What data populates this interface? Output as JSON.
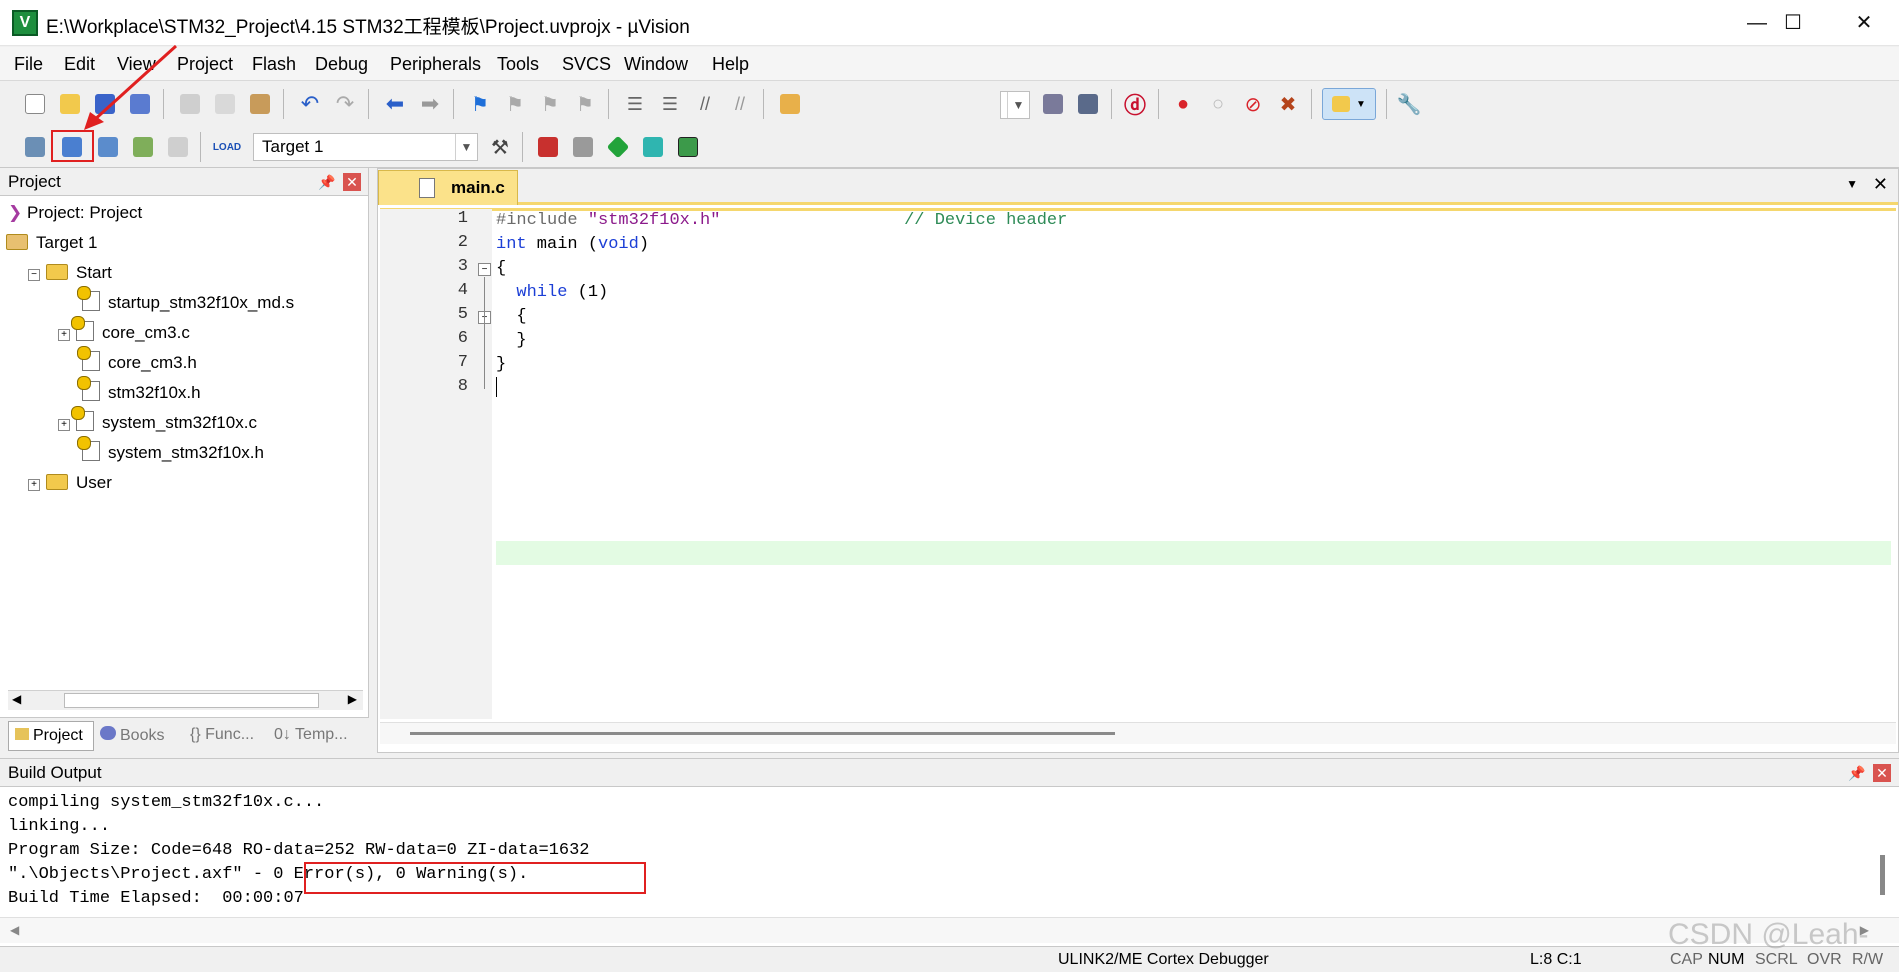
{
  "window": {
    "title": "E:\\Workplace\\STM32_Project\\4.15 STM32工程模板\\Project.uvprojx - µVision",
    "minimize": "—",
    "maximize": "☐",
    "close": "✕"
  },
  "menu": [
    "File",
    "Edit",
    "View",
    "Project",
    "Flash",
    "Debug",
    "Peripherals",
    "Tools",
    "SVCS",
    "Window",
    "Help"
  ],
  "toolbar2": {
    "target_combo": "Target 1"
  },
  "project_panel": {
    "title": "Project",
    "root": "Project: Project",
    "target": "Target 1",
    "group_start": "Start",
    "files": [
      "startup_stm32f10x_md.s",
      "core_cm3.c",
      "core_cm3.h",
      "stm32f10x.h",
      "system_stm32f10x.c",
      "system_stm32f10x.h"
    ],
    "group_user": "User",
    "tabs": [
      "Project",
      "Books",
      "{} Func...",
      "0↓ Temp..."
    ]
  },
  "editor": {
    "tab_label": "main.c",
    "line_numbers": [
      "1",
      "2",
      "3",
      "4",
      "5",
      "6",
      "7",
      "8"
    ],
    "code": {
      "l1_pre": "#include",
      "l1_str": "\"stm32f10x.h\"",
      "l1_cmt": "// Device header",
      "l2_kw": "int",
      "l2_rest": " main (",
      "l2_kw2": "void",
      "l2_end": ")",
      "l3": "{",
      "l4_kw": "while",
      "l4_rest": " (1)",
      "l5": "{",
      "l6": "}",
      "l7": "}"
    }
  },
  "build_output": {
    "title": "Build Output",
    "lines": [
      "compiling system_stm32f10x.c...",
      "linking...",
      "Program Size: Code=648 RO-data=252 RW-data=0 ZI-data=1632",
      "\".\\Objects\\Project.axf\" - 0 Error(s), 0 Warning(s).",
      "Build Time Elapsed:  00:00:07"
    ]
  },
  "statusbar": {
    "debugger": "ULINK2/ME Cortex Debugger",
    "position": "L:8 C:1",
    "caps": "CAP",
    "num": "NUM",
    "scrl": "SCRL",
    "ovr": "OVR",
    "rw": "R/W"
  },
  "watermark": "CSDN @Leah-"
}
